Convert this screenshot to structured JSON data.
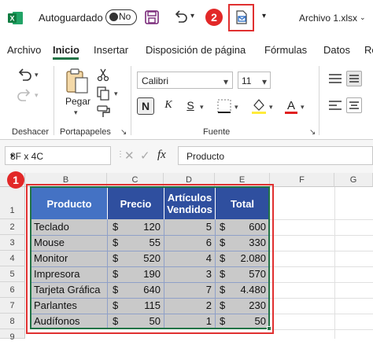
{
  "titlebar": {
    "autosave_label": "Autoguardado",
    "autosave_state": "No",
    "filename": "Archivo 1.xlsx",
    "badge_quick_access": "2",
    "badge_range": "1"
  },
  "tabs": [
    "Archivo",
    "Inicio",
    "Insertar",
    "Disposición de página",
    "Fórmulas",
    "Datos",
    "Re"
  ],
  "ribbon": {
    "groups": {
      "undo": "Deshacer",
      "clipboard": "Portapapeles",
      "font": "Fuente"
    },
    "paste_label": "Pegar",
    "font_name": "Calibri",
    "font_size": "11",
    "bold": "N",
    "italic": "K",
    "underline": "S",
    "font_color": "#e02020"
  },
  "formula_bar": {
    "name_box": "8F x 4C",
    "fx": "fx",
    "content": "Producto"
  },
  "grid": {
    "columns": [
      "B",
      "C",
      "D",
      "E",
      "F",
      "G"
    ],
    "rows": [
      "1",
      "2",
      "3",
      "4",
      "5",
      "6",
      "7",
      "8",
      "9"
    ],
    "header_color": "#2f4f9f",
    "header_first_color": "#4472c4",
    "body_color": "#c9c9c9"
  },
  "table": {
    "headers": [
      "Producto",
      "Precio",
      "Artículos Vendidos",
      "Total"
    ],
    "currency": "$",
    "rows": [
      {
        "producto": "Teclado",
        "precio": "120",
        "vendidos": "5",
        "total": "600"
      },
      {
        "producto": "Mouse",
        "precio": "55",
        "vendidos": "6",
        "total": "330"
      },
      {
        "producto": "Monitor",
        "precio": "520",
        "vendidos": "4",
        "total": "2.080"
      },
      {
        "producto": "Impresora",
        "precio": "190",
        "vendidos": "3",
        "total": "570"
      },
      {
        "producto": "Tarjeta Gráfica",
        "precio": "640",
        "vendidos": "7",
        "total": "4.480"
      },
      {
        "producto": "Parlantes",
        "precio": "115",
        "vendidos": "2",
        "total": "230"
      },
      {
        "producto": "Audífonos",
        "precio": "50",
        "vendidos": "1",
        "total": "50"
      }
    ]
  }
}
